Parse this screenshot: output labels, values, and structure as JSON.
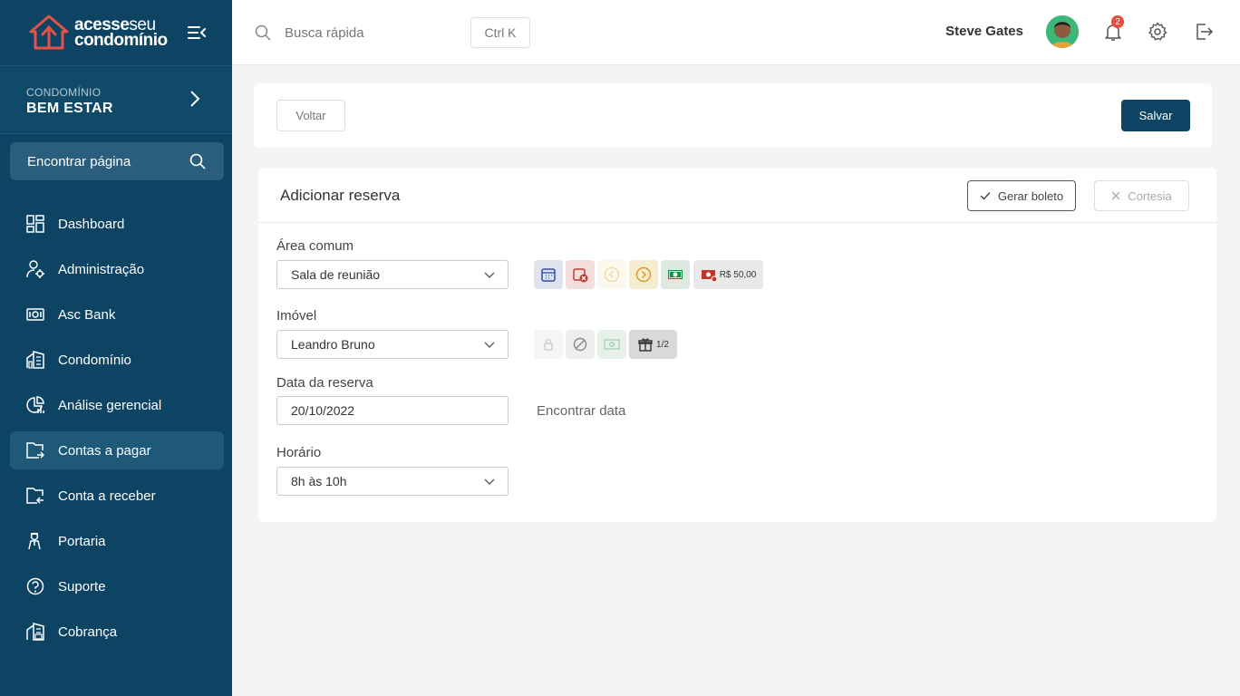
{
  "brand": {
    "line1": "acesse",
    "line1_thin": "seu",
    "line2": "condomínio"
  },
  "condo": {
    "label": "CONDOMÍNIO",
    "name": "BEM ESTAR"
  },
  "sidebar": {
    "find_page": "Encontrar página",
    "items": [
      {
        "label": "Dashboard",
        "icon": "dashboard-icon"
      },
      {
        "label": "Administração",
        "icon": "admin-user-gear-icon"
      },
      {
        "label": "Asc Bank",
        "icon": "bank-money-icon"
      },
      {
        "label": "Condomínio",
        "icon": "building-icon"
      },
      {
        "label": "Análise gerencial",
        "icon": "chart-pie-icon"
      },
      {
        "label": "Contas a pagar",
        "icon": "folder-out-icon"
      },
      {
        "label": "Conta a receber",
        "icon": "folder-in-icon"
      },
      {
        "label": "Portaria",
        "icon": "guard-icon"
      },
      {
        "label": "Suporte",
        "icon": "help-circle-icon"
      },
      {
        "label": "Cobrança",
        "icon": "building-money-icon"
      }
    ],
    "active_index": 5
  },
  "header": {
    "search_placeholder": "Busca rápida",
    "shortcut": "Ctrl K",
    "user_name": "Steve Gates",
    "notifications": "2"
  },
  "actions": {
    "back": "Voltar",
    "save": "Salvar"
  },
  "form": {
    "title": "Adicionar reserva",
    "generate_boleto": "Gerar boleto",
    "cortesia": "Cortesia",
    "area_label": "Área comum",
    "area_value": "Sala de reunião",
    "property_label": "Imóvel",
    "property_value": "Leandro Bruno",
    "date_label": "Data da reserva",
    "date_value": "20/10/2022",
    "find_date": "Encontrar data",
    "time_label": "Horário",
    "time_value": "8h às 10h",
    "area_price": "R$ 50,00",
    "property_ratio": "1/2"
  },
  "colors": {
    "sidebar": "#0d4463",
    "accent": "#0d4463",
    "active": "#1f5978"
  }
}
